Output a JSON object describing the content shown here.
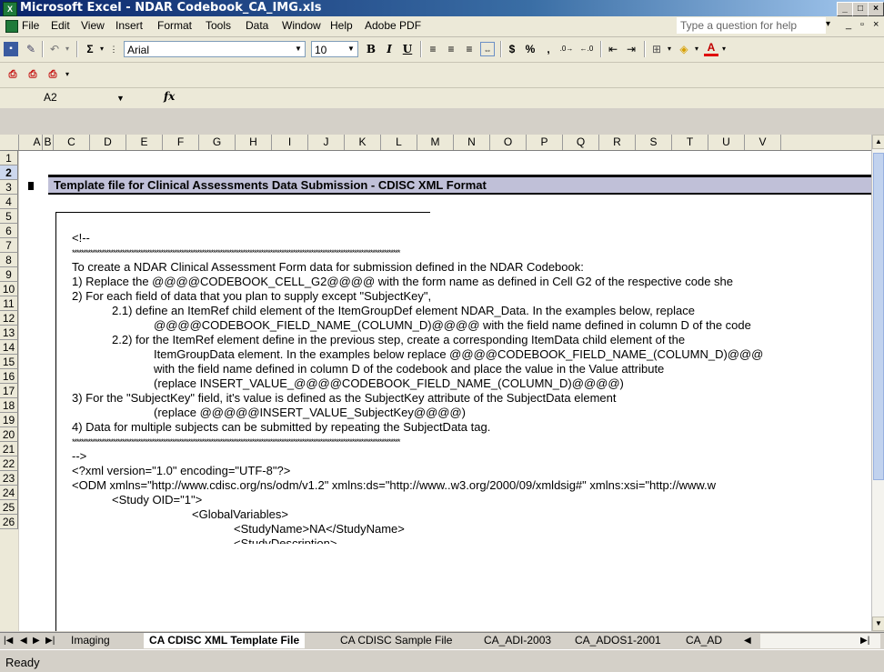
{
  "window": {
    "title": "Microsoft Excel - NDAR Codebook_CA_IMG.xls",
    "app_icon": "excel-icon",
    "controls": [
      "minimize-icon",
      "maximize-icon",
      "close-icon"
    ]
  },
  "menu": {
    "items": [
      "File",
      "Edit",
      "View",
      "Insert",
      "Format",
      "Tools",
      "Data",
      "Window",
      "Help",
      "Adobe PDF"
    ],
    "help_placeholder": "Type a question for help"
  },
  "toolbar": {
    "font_name": "Arial",
    "font_size": "10",
    "bold": "B",
    "italic": "I",
    "underline": "U",
    "currency": "$",
    "percent": "%",
    "comma": ",",
    "sigma": "Σ",
    "font_color_glyph": "A"
  },
  "formula_bar": {
    "cell_ref": "A2",
    "fx_label": "fx",
    "formula": ""
  },
  "columns": [
    "A",
    "B",
    "C",
    "D",
    "E",
    "F",
    "G",
    "H",
    "I",
    "J",
    "K",
    "L",
    "M",
    "N",
    "O",
    "P",
    "Q",
    "R",
    "S",
    "T",
    "U",
    "V"
  ],
  "rows": [
    "1",
    "2",
    "3",
    "4",
    "5",
    "6",
    "7",
    "8",
    "9",
    "10",
    "11",
    "12",
    "13",
    "14",
    "15",
    "16",
    "17",
    "18",
    "19",
    "20",
    "21",
    "22",
    "23",
    "24",
    "25",
    "26"
  ],
  "sheet": {
    "banner_title": "Template file for Clinical Assessments Data Submission - CDISC XML Format",
    "lines": [
      "<!--",
      "************************************************************************************************************************************************",
      "To create a NDAR Clinical Assessment Form data for submission defined in the NDAR Codebook:",
      "1) Replace the @@@@CODEBOOK_CELL_G2@@@@ with the form name as defined in Cell G2 of the respective code she",
      "2) For each field of data that you plan to supply except \"SubjectKey\",",
      "2.1)    define an ItemRef child element of the ItemGroupDef element NDAR_Data.  In the examples below, replace",
      "@@@@CODEBOOK_FIELD_NAME_(COLUMN_D)@@@@ with the field name defined in column D of the code",
      "2.2)    for the ItemRef element define in the previous step, create a corresponding ItemData child element of the",
      "ItemGroupData element.  In the examples below replace @@@@CODEBOOK_FIELD_NAME_(COLUMN_D)@@@",
      "with the field name defined in column D of the codebook and place the value in the Value attribute",
      "(replace INSERT_VALUE_@@@@CODEBOOK_FIELD_NAME_(COLUMN_D)@@@@)",
      "3) For the \"SubjectKey\" field, it's value is defined as the SubjectKey attribute of the SubjectData element",
      "(replace @@@@@INSERT_VALUE_SubjectKey@@@@)",
      "4) Data for multiple subjects can be submitted by repeating the SubjectData tag.",
      "************************************************************************************************************************************************",
      "-->",
      "<?xml version=\"1.0\" encoding=\"UTF-8\"?>",
      "<ODM xmlns=\"http://www.cdisc.org/ns/odm/v1.2\" xmlns:ds=\"http://www..w3.org/2000/09/xmldsig#\" xmlns:xsi=\"http://www.w",
      "<Study OID=\"1\">",
      "<GlobalVariables>",
      "<StudyName>NA</StudyName>",
      "<StudyDescription>"
    ]
  },
  "tabs": [
    "Imaging",
    "CA CDISC XML Template File",
    "CA CDISC Sample File",
    "CA_ADI-2003",
    "CA_ADOS1-2001",
    "CA_AD"
  ],
  "active_tab": "CA CDISC XML Template File",
  "status": "Ready"
}
